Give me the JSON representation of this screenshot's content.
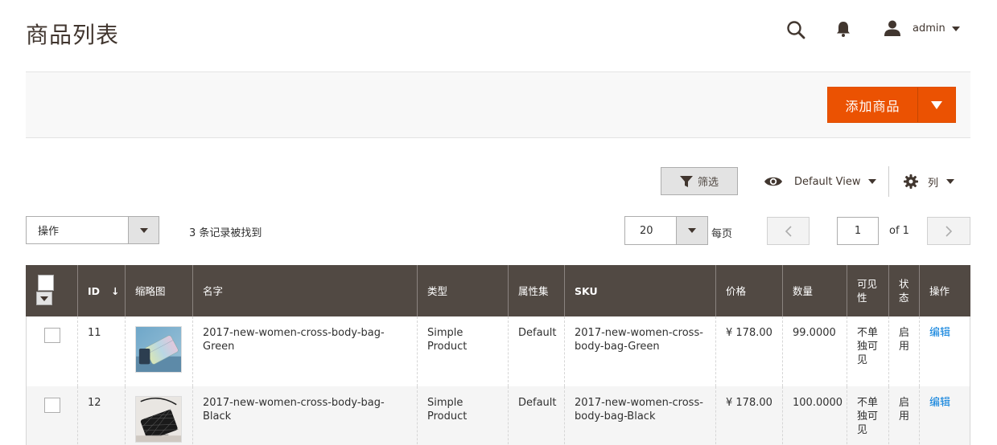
{
  "page": {
    "title": "商品列表"
  },
  "header": {
    "user": "admin"
  },
  "toolbar": {
    "add_product": "添加商品"
  },
  "controls": {
    "filter": "筛选",
    "view": "Default View",
    "columns": "列"
  },
  "mass_actions": {
    "label": "操作",
    "records_found": "3 条记录被找到"
  },
  "pagination": {
    "per_page": "20",
    "per_page_label": "每页",
    "current_page": "1",
    "of_pages": "of 1"
  },
  "grid": {
    "columns": [
      "ID",
      "缩略图",
      "名字",
      "类型",
      "属性集",
      "SKU",
      "价格",
      "数量",
      "可见性",
      "状态",
      "操作"
    ],
    "rows": [
      {
        "id": "11",
        "name": "2017-new-women-cross-body-bag-Green",
        "type": "Simple Product",
        "attr_set": "Default",
        "sku": "2017-new-women-cross-body-bag-Green",
        "price": "¥ 178.00",
        "qty": "99.0000",
        "visibility": "不单独可见",
        "status": "启用",
        "action": "编辑",
        "thumb": "green-bag-photo"
      },
      {
        "id": "12",
        "name": "2017-new-women-cross-body-bag-Black",
        "type": "Simple Product",
        "attr_set": "Default",
        "sku": "2017-new-women-cross-body-bag-Black",
        "price": "¥ 178.00",
        "qty": "100.0000",
        "visibility": "不单独可见",
        "status": "启用",
        "action": "编辑",
        "thumb": "black-bag-photo"
      }
    ]
  },
  "colors": {
    "accent": "#eb5202",
    "header_bg": "#514943",
    "link": "#007bdb"
  }
}
